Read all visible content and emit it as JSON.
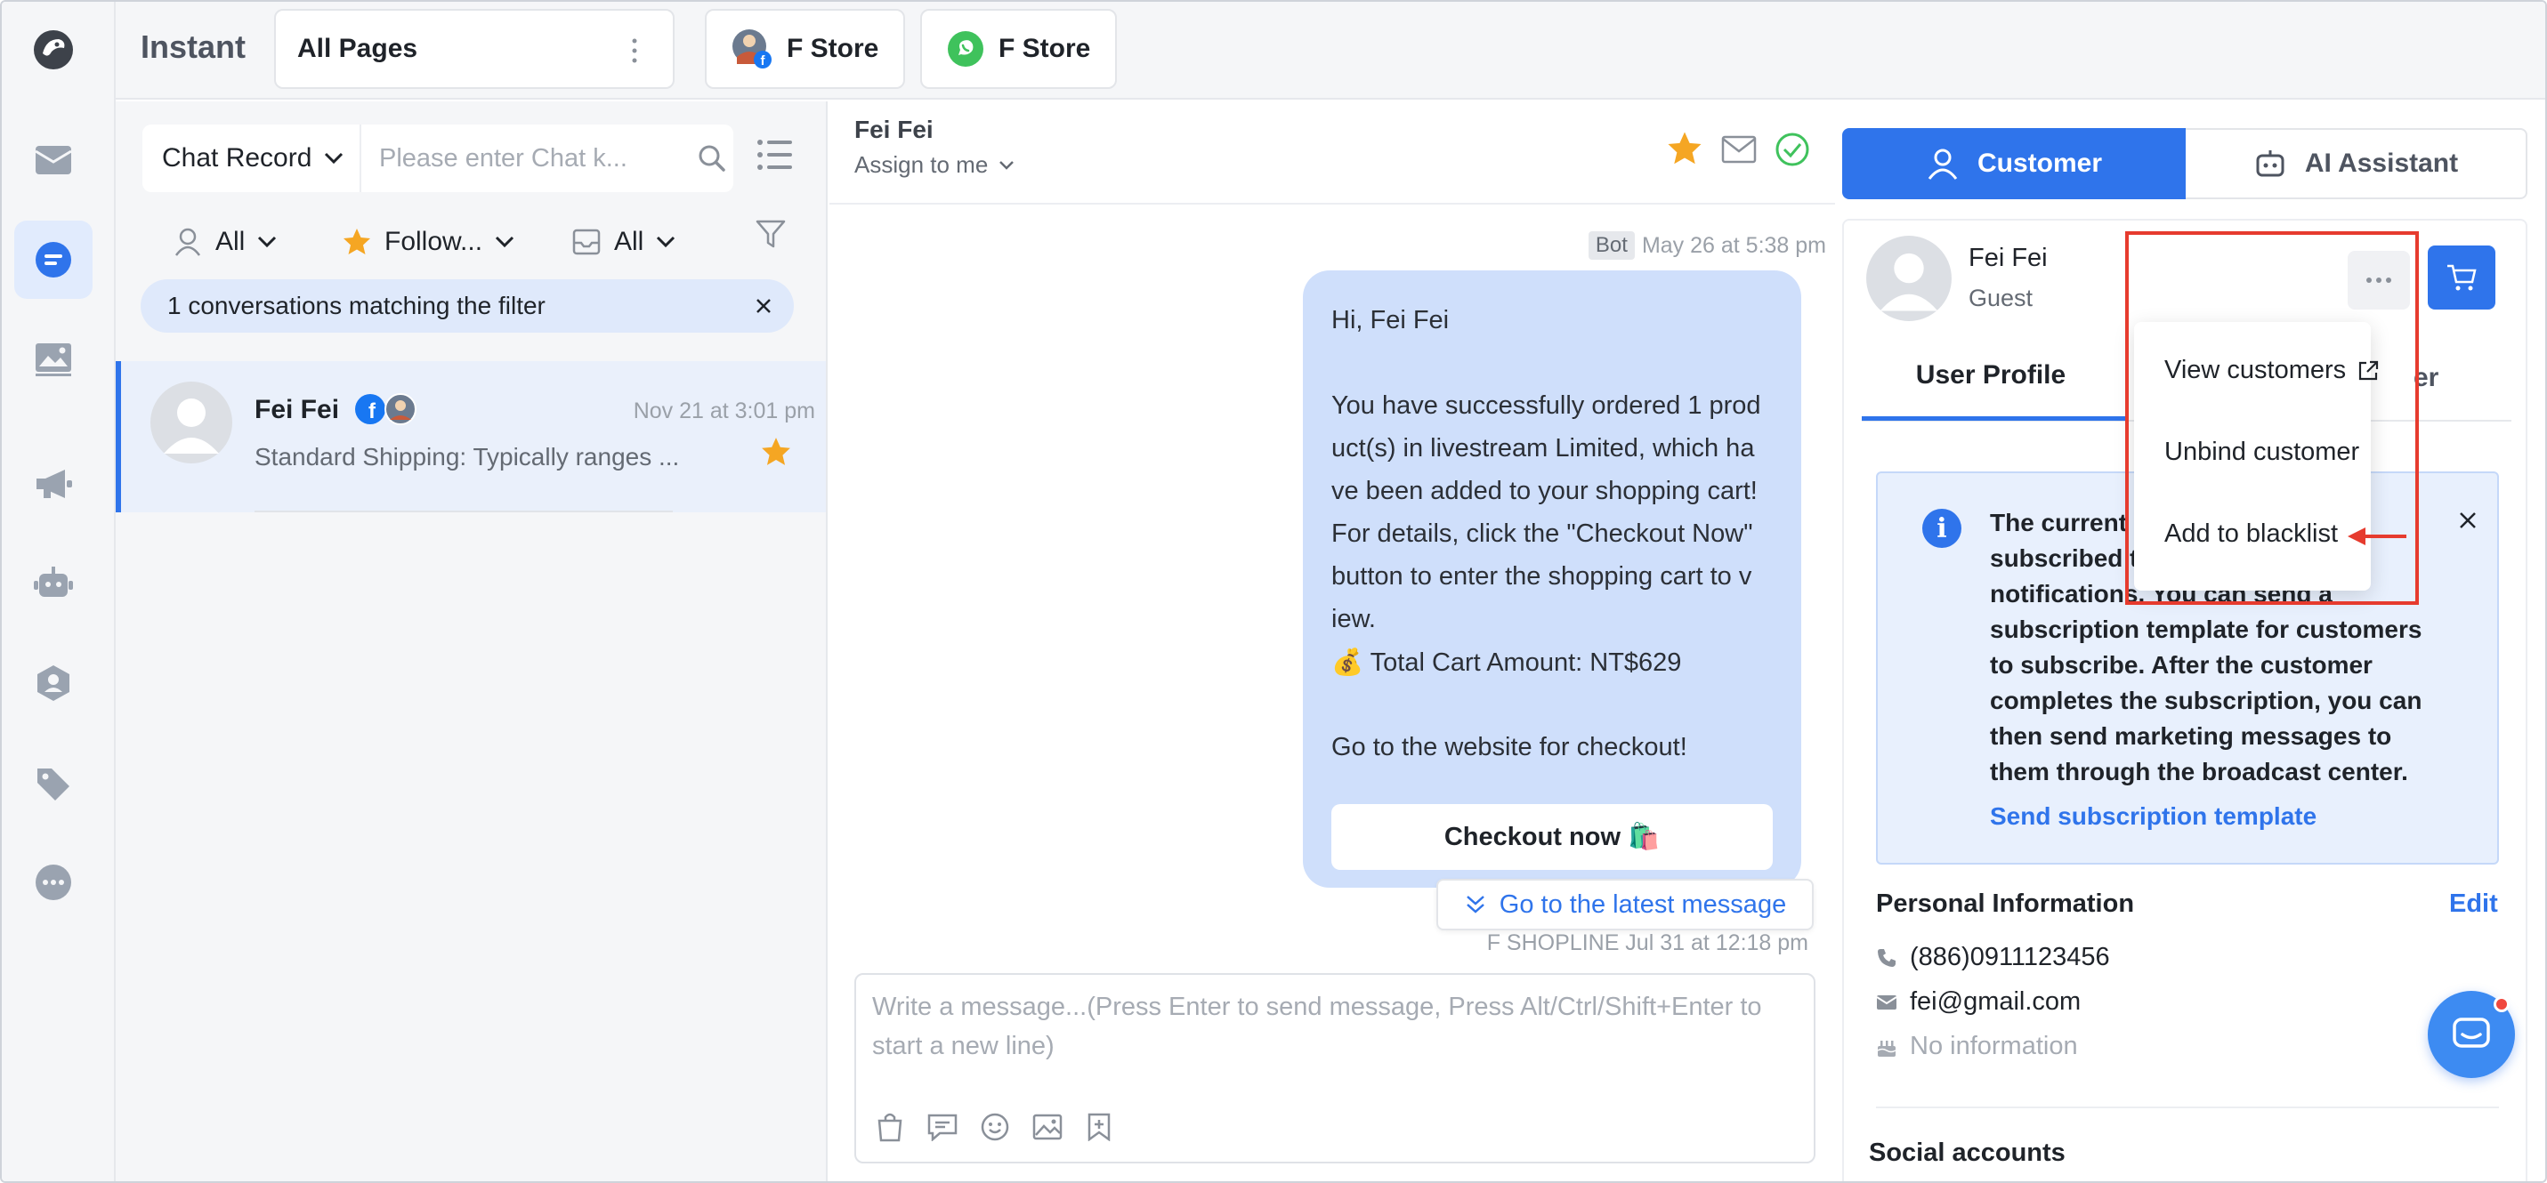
{
  "app": {
    "title": "Instant"
  },
  "topbar": {
    "page_select": "All Pages",
    "stores": [
      {
        "label": "F Store",
        "channel": "facebook"
      },
      {
        "label": "F Store",
        "channel": "whatsapp"
      }
    ]
  },
  "rail": {
    "items": [
      "logo-icon",
      "inbox-icon",
      "chat-icon",
      "gallery-icon",
      "megaphone-icon",
      "robot-icon",
      "team-icon",
      "tag-icon",
      "more-icon"
    ],
    "active": "chat-icon"
  },
  "convlist": {
    "search_scope": "Chat Record",
    "search_placeholder": "Please enter Chat k...",
    "filters": {
      "assignee": "All",
      "follow": "Follow...",
      "inbox": "All"
    },
    "match_banner": "1 conversations matching the filter",
    "items": [
      {
        "name": "Fei Fei",
        "time": "Nov 21 at 3:01 pm",
        "preview": "Standard Shipping: Typically ranges ...",
        "starred": true
      }
    ]
  },
  "chat": {
    "contact_name": "Fei Fei",
    "assign_label": "Assign to me",
    "bot_tag": "Bot",
    "bot_time": "May 26 at 5:38 pm",
    "message_lines": [
      "Hi, Fei Fei",
      "",
      "You have successfully ordered 1 prod",
      "uct(s) in livestream Limited, which ha",
      "ve been added to your shopping cart!",
      "For details, click the \"Checkout Now\"",
      "button to enter the shopping cart to v",
      "iew.",
      "💰 Total Cart Amount: NT$629",
      "",
      "Go to the website for checkout!"
    ],
    "checkout_label": "Checkout now 🛍️",
    "latest_message_label": "Go to the latest message",
    "sender_meta": "F SHOPLINE Jul 31 at 12:18 pm",
    "composer_placeholder": "Write a message...(Press Enter to send message, Press Alt/Ctrl/Shift+Enter to start a new line)"
  },
  "right_panel": {
    "tabs": {
      "customer": "Customer",
      "ai": "AI Assistant"
    },
    "customer_name": "Fei Fei",
    "customer_role": "Guest",
    "profile_tab": "User Profile",
    "other_tab_suffix": "er",
    "notice_text": "The current customer is not subscribed to receive marketing notifications. You can send a subscription template for customers to subscribe. After the customer completes the subscription, you can then send marketing messages to them through the broadcast center.",
    "notice_visible_lines": [
      "The current c",
      "subscribed t",
      "notifications. You can send a",
      "subscription template for customers",
      "to subscribe. After the customer",
      "completes the subscription, you can",
      "then send marketing messages to",
      "them through the broadcast center."
    ],
    "notice_link": "Send subscription template",
    "personal_info_title": "Personal Information",
    "edit_label": "Edit",
    "phone": "(886)0911123456",
    "email": "fei@gmail.com",
    "birthday": "No information",
    "social_title": "Social accounts"
  },
  "dropdown": {
    "items": [
      "View customers",
      "Unbind customer",
      "Add to blacklist"
    ]
  },
  "colors": {
    "accent": "#2f74eb",
    "highlight": "#e63b2e",
    "star": "#f5a623",
    "bubble": "#cfdffb"
  }
}
